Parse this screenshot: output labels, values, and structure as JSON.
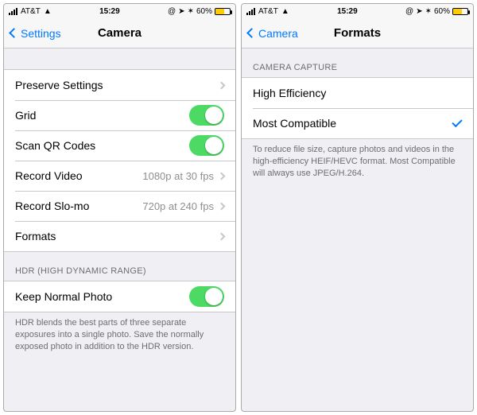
{
  "left": {
    "status": {
      "carrier": "AT&T",
      "time": "15:29",
      "battery": "60%"
    },
    "nav": {
      "back": "Settings",
      "title": "Camera"
    },
    "group1": {
      "preserve": "Preserve Settings",
      "grid": "Grid",
      "scan_qr": "Scan QR Codes",
      "record_video": "Record Video",
      "record_video_val": "1080p at 30 fps",
      "record_slomo": "Record Slo-mo",
      "record_slomo_val": "720p at 240 fps",
      "formats": "Formats"
    },
    "hdr_header": "HDR (High Dynamic Range)",
    "hdr_row": "Keep Normal Photo",
    "hdr_footer": "HDR blends the best parts of three separate exposures into a single photo. Save the normally exposed photo in addition to the HDR version."
  },
  "right": {
    "status": {
      "carrier": "AT&T",
      "time": "15:29",
      "battery": "60%"
    },
    "nav": {
      "back": "Camera",
      "title": "Formats"
    },
    "header": "Camera Capture",
    "high_efficiency": "High Efficiency",
    "most_compatible": "Most Compatible",
    "footer": "To reduce file size, capture photos and videos in the high-efficiency HEIF/HEVC format. Most Compatible will always use JPEG/H.264."
  }
}
